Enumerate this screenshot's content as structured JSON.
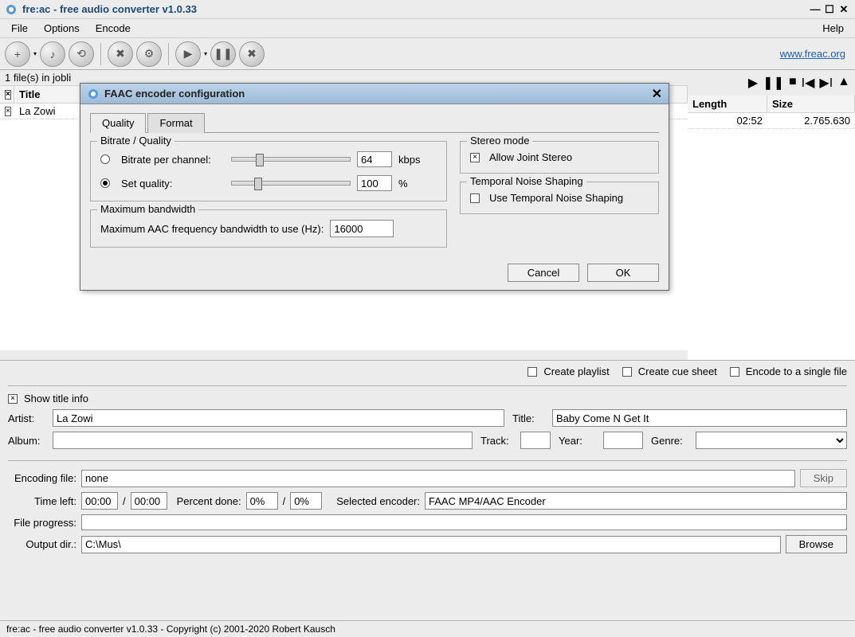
{
  "titlebar": {
    "title": "fre:ac - free audio converter v1.0.33"
  },
  "menubar": {
    "file": "File",
    "options": "Options",
    "encode": "Encode",
    "help": "Help"
  },
  "toolbar": {
    "link": "www.freac.org"
  },
  "joblist": {
    "header": "1 file(s) in jobli",
    "columns": {
      "title": "Title",
      "length": "Length",
      "size": "Size"
    },
    "row": {
      "title": "La Zowi",
      "length": "02:52",
      "size": "2.765.630"
    }
  },
  "options": {
    "create_playlist": "Create playlist",
    "create_cue": "Create cue sheet",
    "encode_single": "Encode to a single file"
  },
  "titleinfo": {
    "show": "Show title info",
    "artist_label": "Artist:",
    "artist": "La Zowi",
    "title_label": "Title:",
    "title": "Baby Come N Get It",
    "album_label": "Album:",
    "album": "",
    "track_label": "Track:",
    "track": "",
    "year_label": "Year:",
    "year": "",
    "genre_label": "Genre:",
    "genre": ""
  },
  "encoding": {
    "encoding_file_label": "Encoding file:",
    "encoding_file": "none",
    "skip": "Skip",
    "time_left_label": "Time left:",
    "time_left_a": "00:00",
    "time_left_b": "00:00",
    "percent_label": "Percent done:",
    "percent_a": "0%",
    "percent_b": "0%",
    "encoder_label": "Selected encoder:",
    "encoder": "FAAC MP4/AAC Encoder",
    "file_progress_label": "File progress:",
    "outdir_label": "Output dir.:",
    "outdir": "C:\\Mus\\",
    "browse": "Browse"
  },
  "statusbar": "fre:ac - free audio converter v1.0.33 - Copyright (c) 2001-2020 Robert Kausch",
  "dialog": {
    "title": "FAAC encoder configuration",
    "tabs": {
      "quality": "Quality",
      "format": "Format"
    },
    "bitrate_group": "Bitrate / Quality",
    "bitrate_per_channel": "Bitrate per channel:",
    "bitrate_value": "64",
    "bitrate_unit": "kbps",
    "set_quality": "Set quality:",
    "quality_value": "100",
    "quality_unit": "%",
    "bandwidth_group": "Maximum bandwidth",
    "bandwidth_label": "Maximum AAC frequency bandwidth to use (Hz):",
    "bandwidth_value": "16000",
    "stereo_group": "Stereo mode",
    "allow_joint": "Allow Joint Stereo",
    "tns_group": "Temporal Noise Shaping",
    "use_tns": "Use Temporal Noise Shaping",
    "cancel": "Cancel",
    "ok": "OK"
  }
}
